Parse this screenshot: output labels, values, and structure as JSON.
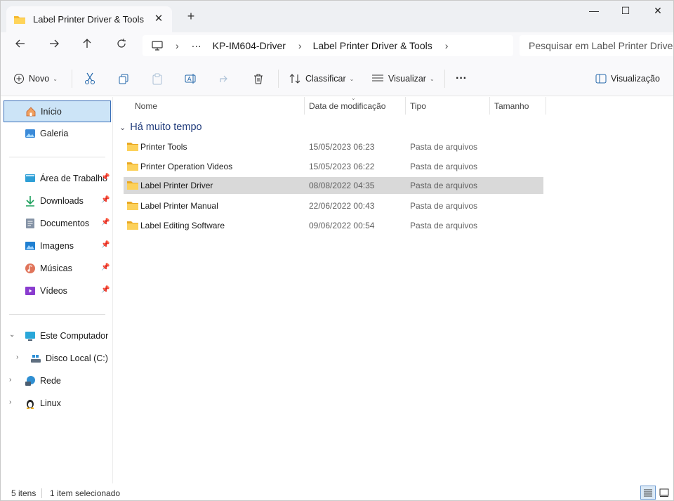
{
  "window": {
    "tab_title": "Label Printer Driver & Tools",
    "new_tab_symbol": "+",
    "close_tab_symbol": "✕",
    "controls": {
      "minimize": "—",
      "maximize": "☐",
      "close": "✕"
    }
  },
  "address": {
    "overflow": "···",
    "breadcrumbs": [
      "KP-IM604-Driver",
      "Label Printer Driver & Tools"
    ],
    "search_placeholder": "Pesquisar em Label Printer Driver"
  },
  "toolbar": {
    "new_label": "Novo",
    "sort_label": "Classificar",
    "view_label": "Visualizar",
    "more_label": "···",
    "preview_label": "Visualização"
  },
  "sidebar": {
    "top": [
      {
        "label": "Início",
        "icon": "home-icon",
        "selected": true
      },
      {
        "label": "Galeria",
        "icon": "gallery-icon",
        "selected": false
      }
    ],
    "quick_access": [
      {
        "label": "Área de Trabalho",
        "icon": "desktop-icon"
      },
      {
        "label": "Downloads",
        "icon": "download-icon"
      },
      {
        "label": "Documentos",
        "icon": "document-icon"
      },
      {
        "label": "Imagens",
        "icon": "pictures-icon"
      },
      {
        "label": "Músicas",
        "icon": "music-icon"
      },
      {
        "label": "Vídeos",
        "icon": "videos-icon"
      }
    ],
    "tree": [
      {
        "label": "Este Computador",
        "icon": "computer-icon",
        "expanded": true
      },
      {
        "label": "Disco Local (C:)",
        "icon": "drive-icon",
        "expanded": false
      },
      {
        "label": "Rede",
        "icon": "network-icon",
        "expanded": false
      },
      {
        "label": "Linux",
        "icon": "linux-icon",
        "expanded": false
      }
    ]
  },
  "content": {
    "columns": [
      "Nome",
      "Data de modificação",
      "Tipo",
      "Tamanho"
    ],
    "group_title": "Há muito tempo",
    "rows": [
      {
        "name": "Printer Tools",
        "date": "15/05/2023 06:23",
        "type": "Pasta de arquivos",
        "selected": false
      },
      {
        "name": "Printer Operation Videos",
        "date": "15/05/2023 06:22",
        "type": "Pasta de arquivos",
        "selected": false
      },
      {
        "name": "Label Printer Driver",
        "date": "08/08/2022 04:35",
        "type": "Pasta de arquivos",
        "selected": true
      },
      {
        "name": "Label Printer Manual",
        "date": "22/06/2022 00:43",
        "type": "Pasta de arquivos",
        "selected": false
      },
      {
        "name": "Label Editing Software",
        "date": "09/06/2022 00:54",
        "type": "Pasta de arquivos",
        "selected": false
      }
    ]
  },
  "status": {
    "item_count": "5 itens",
    "selected_count": "1 item selecionado"
  },
  "colors": {
    "accent": "#0067c0",
    "selection_nav": "#cce4f7",
    "selection_row": "#d9d9d9",
    "folder": "#f8c740"
  }
}
